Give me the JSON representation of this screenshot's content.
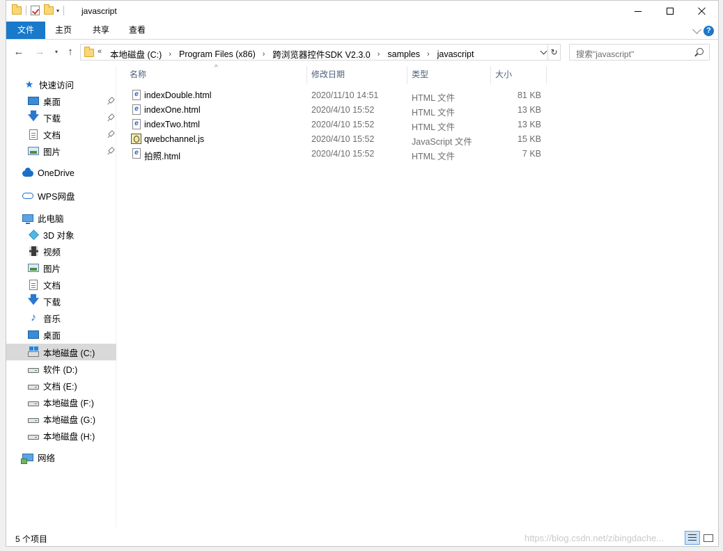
{
  "window": {
    "title": "javascript"
  },
  "ribbon": {
    "tabs": [
      "文件",
      "主页",
      "共享",
      "查看"
    ]
  },
  "address": {
    "overflow": "«",
    "crumbs": [
      "本地磁盘 (C:)",
      "Program Files (x86)",
      "跨浏览器控件SDK V2.3.0",
      "samples",
      "javascript"
    ]
  },
  "search": {
    "placeholder": "搜索\"javascript\""
  },
  "sidebar": {
    "quick_access": "快速访问",
    "quick_items": [
      "桌面",
      "下载",
      "文档",
      "图片"
    ],
    "onedrive": "OneDrive",
    "wps": "WPS网盘",
    "this_pc": "此电脑",
    "pc_items": [
      "3D 对象",
      "视频",
      "图片",
      "文档",
      "下载",
      "音乐",
      "桌面"
    ],
    "drives": [
      "本地磁盘 (C:)",
      "软件 (D:)",
      "文档 (E:)",
      "本地磁盘 (F:)",
      "本地磁盘 (G:)",
      "本地磁盘 (H:)"
    ],
    "network": "网络",
    "selected": "本地磁盘 (C:)"
  },
  "columns": {
    "name": "名称",
    "date": "修改日期",
    "type": "类型",
    "size": "大小"
  },
  "files": [
    {
      "name": "indexDouble.html",
      "date": "2020/11/10 14:51",
      "type": "HTML 文件",
      "size": "81 KB",
      "icon": "html-file-icon"
    },
    {
      "name": "indexOne.html",
      "date": "2020/4/10 15:52",
      "type": "HTML 文件",
      "size": "13 KB",
      "icon": "html-file-icon"
    },
    {
      "name": "indexTwo.html",
      "date": "2020/4/10 15:52",
      "type": "HTML 文件",
      "size": "13 KB",
      "icon": "html-file-icon"
    },
    {
      "name": "qwebchannel.js",
      "date": "2020/4/10 15:52",
      "type": "JavaScript 文件",
      "size": "15 KB",
      "icon": "js-file-icon"
    },
    {
      "name": "拍照.html",
      "date": "2020/4/10 15:52",
      "type": "HTML 文件",
      "size": "7 KB",
      "icon": "html-file-icon"
    }
  ],
  "status": {
    "count": "5 个项目",
    "watermark": "https://blog.csdn.net/zibingdache..."
  },
  "colors": {
    "accent": "#1979ca",
    "selection": "#d9d9d9"
  }
}
